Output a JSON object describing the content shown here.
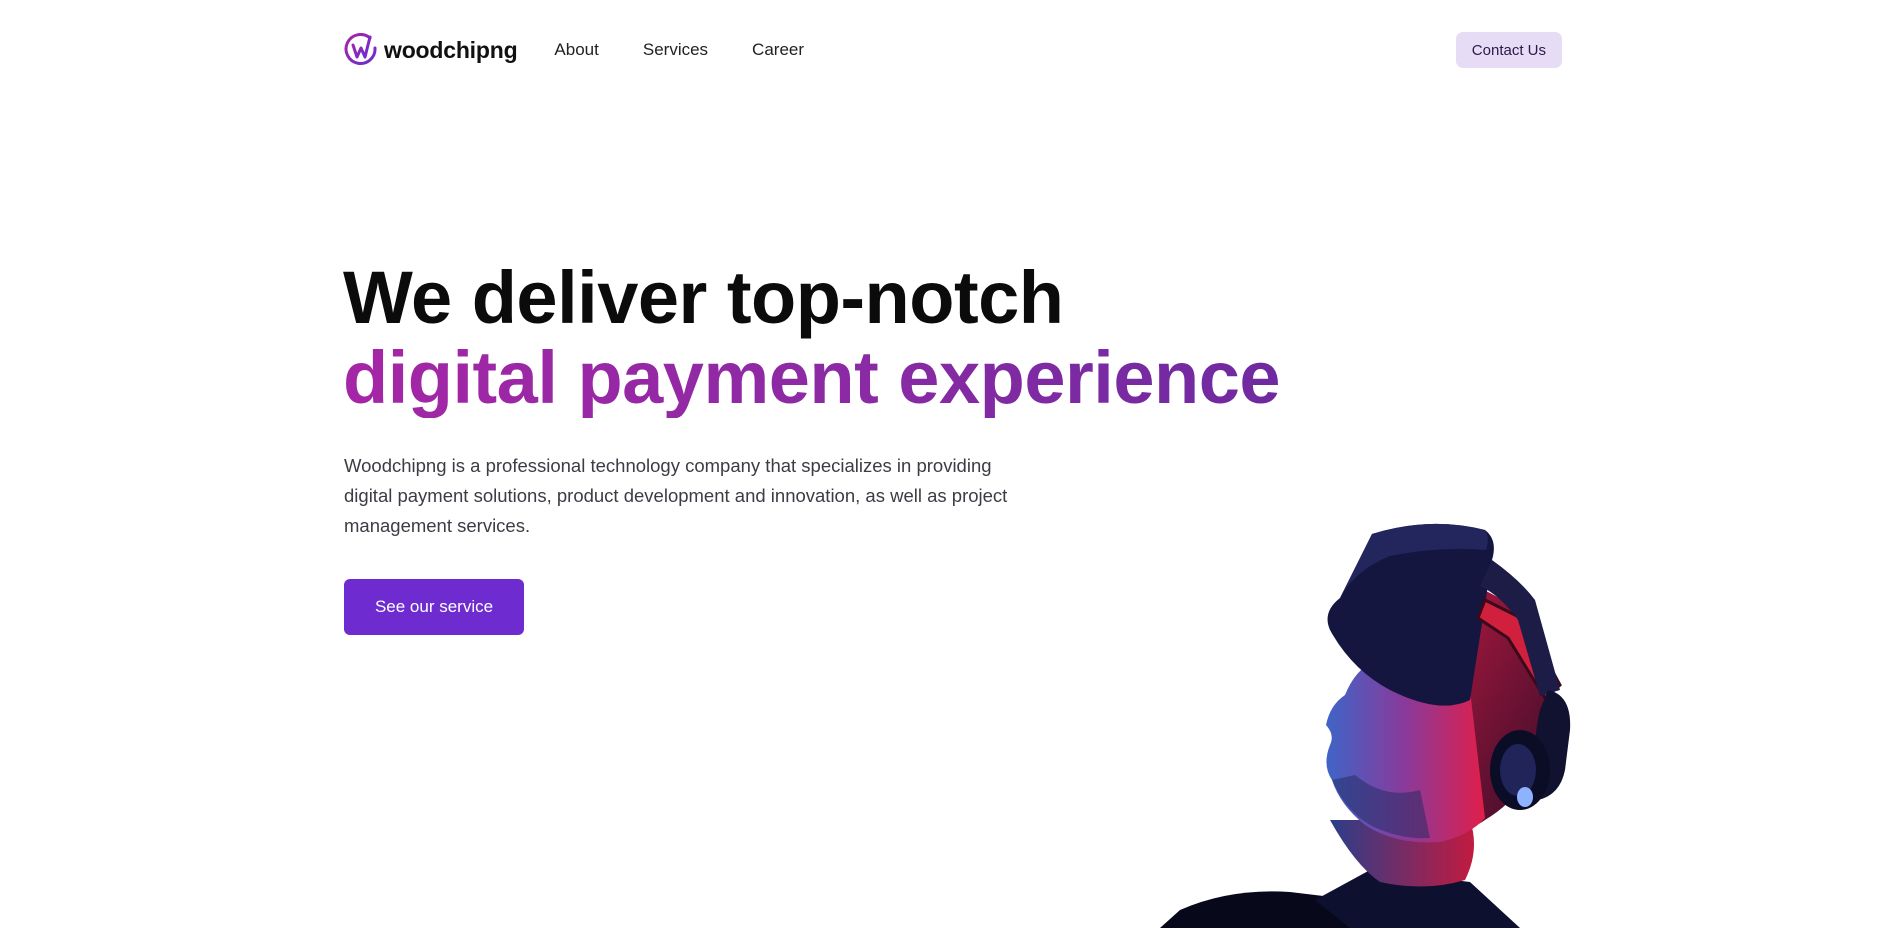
{
  "header": {
    "brand_name": "woodchipng",
    "nav": [
      {
        "label": "About"
      },
      {
        "label": "Services"
      },
      {
        "label": "Career"
      }
    ],
    "contact_label": "Contact Us"
  },
  "hero": {
    "title_line1": "We deliver top-notch",
    "title_line2": "digital payment experience",
    "description": "Woodchipng is a professional technology company that specializes in providing digital payment solutions, product development and innovation, as well as project management services.",
    "cta_label": "See our service"
  },
  "colors": {
    "brand_purple": "#6d2bd0",
    "accent_magenta": "#a526a6",
    "contact_bg": "#e6dcf5"
  },
  "icons": {
    "logo": "woodchipng-logo-icon"
  }
}
